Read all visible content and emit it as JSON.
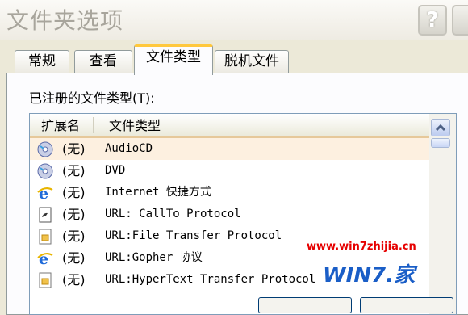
{
  "window": {
    "title": "文件夹选项",
    "help_label": "?"
  },
  "tabs": [
    {
      "label": "常规"
    },
    {
      "label": "查看"
    },
    {
      "label": "文件类型"
    },
    {
      "label": "脱机文件"
    }
  ],
  "registered_label": "已注册的文件类型(T):",
  "columns": {
    "extension": "扩展名",
    "file_type": "文件类型"
  },
  "rows": [
    {
      "ext": "(无)",
      "type": "AudioCD",
      "icon": "audio-cd-icon"
    },
    {
      "ext": "(无)",
      "type": "DVD",
      "icon": "dvd-icon"
    },
    {
      "ext": "(无)",
      "type": "Internet 快捷方式",
      "icon": "internet-explorer-icon"
    },
    {
      "ext": "(无)",
      "type": "URL: CallTo Protocol",
      "icon": "callto-icon"
    },
    {
      "ext": "(无)",
      "type": "URL:File Transfer Protocol",
      "icon": "ftp-folder-icon"
    },
    {
      "ext": "(无)",
      "type": "URL:Gopher 协议",
      "icon": "internet-explorer-icon"
    },
    {
      "ext": "(无)",
      "type": "URL:HyperText Transfer Protocol",
      "icon": "document-icon"
    }
  ],
  "watermark": {
    "url": "www.win7zhijia.cn",
    "logo": "WIN7.家"
  }
}
